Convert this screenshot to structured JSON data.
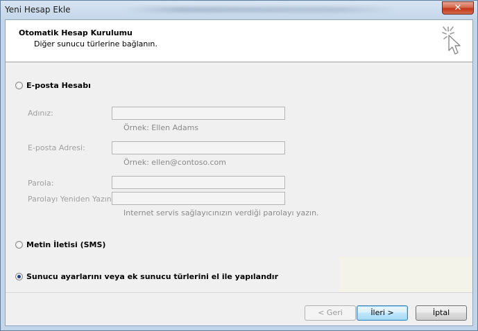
{
  "window": {
    "title": "Yeni Hesap Ekle",
    "close_glyph": "✕"
  },
  "header": {
    "title": "Otomatik Hesap Kurulumu",
    "subtitle": "Diğer sunucu türlerine bağlanın.",
    "icon": "wizard-cursor-icon"
  },
  "options": {
    "email_account": {
      "label": "E-posta Hesabı",
      "selected": false
    },
    "sms": {
      "label": "Metin İletisi (SMS)",
      "selected": false
    },
    "manual": {
      "label": "Sunucu ayarlarını veya ek sunucu türlerini el ile yapılandır",
      "selected": true
    }
  },
  "form": {
    "name_label": "Adınız:",
    "name_value": "",
    "name_hint": "Örnek: Ellen Adams",
    "email_label": "E-posta Adresi:",
    "email_value": "",
    "email_hint": "Örnek: ellen@contoso.com",
    "password_label": "Parola:",
    "password_value": "",
    "password_confirm_label": "Parolayı Yeniden Yazın:",
    "password_confirm_value": "",
    "password_hint": "Internet servis sağlayıcınızın verdiği parolayı yazın."
  },
  "buttons": {
    "back": "< Geri",
    "next": "İleri >",
    "cancel": "İptal"
  }
}
